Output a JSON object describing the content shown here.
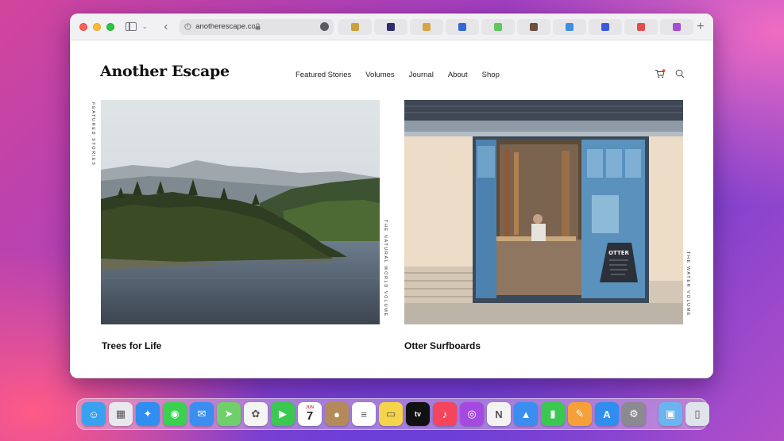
{
  "browser": {
    "url": "anotherescape.com",
    "tab_favicons": [
      "#c8a23a",
      "#2b2d6e",
      "#d9a441",
      "#2f6ad8",
      "#5ec85a",
      "#6b5040",
      "#3f8fe0",
      "#3b5bd8",
      "#e04d4d",
      "#a64ad8"
    ]
  },
  "site": {
    "logo": "Another Escape",
    "nav": [
      "Featured Stories",
      "Volumes",
      "Journal",
      "About",
      "Shop"
    ]
  },
  "content": {
    "section_label": "FEATURED STORIES",
    "stories": [
      {
        "title": "Trees for Life",
        "volume_label": "THE NATURAL WORLD VOLUME"
      },
      {
        "title": "Otter Surfboards",
        "volume_label": "THE WATER VOLUME",
        "sign_text": "OTTER"
      }
    ]
  },
  "dock": {
    "calendar_month": "JUN",
    "calendar_day": "7",
    "tv_label": "tv",
    "apps": [
      {
        "name": "finder",
        "color": "#3aa0f0"
      },
      {
        "name": "launchpad",
        "color": "#e8e8ee"
      },
      {
        "name": "safari",
        "color": "#2f8ef0"
      },
      {
        "name": "messages",
        "color": "#3ad052"
      },
      {
        "name": "mail",
        "color": "#3a8ef0"
      },
      {
        "name": "maps",
        "color": "#6fcf6a"
      },
      {
        "name": "photos",
        "color": "#f4f4f4"
      },
      {
        "name": "facetime",
        "color": "#3ac850"
      },
      {
        "name": "calendar",
        "color": "#ffffff"
      },
      {
        "name": "contacts",
        "color": "#b58a5a"
      },
      {
        "name": "reminders",
        "color": "#ffffff"
      },
      {
        "name": "notes",
        "color": "#f6d44a"
      },
      {
        "name": "tv",
        "color": "#111111"
      },
      {
        "name": "music",
        "color": "#f5455c"
      },
      {
        "name": "podcasts",
        "color": "#a649e0"
      },
      {
        "name": "news",
        "color": "#f3f3f3"
      },
      {
        "name": "keynote",
        "color": "#3a8ef0"
      },
      {
        "name": "numbers",
        "color": "#3ac850"
      },
      {
        "name": "pages",
        "color": "#f6a03a"
      },
      {
        "name": "app-store",
        "color": "#2f8ef0"
      },
      {
        "name": "system-preferences",
        "color": "#8a8a90"
      },
      {
        "name": "downloads",
        "color": "#6ab4f0"
      },
      {
        "name": "trash",
        "color": "#dfe3ea"
      }
    ]
  }
}
